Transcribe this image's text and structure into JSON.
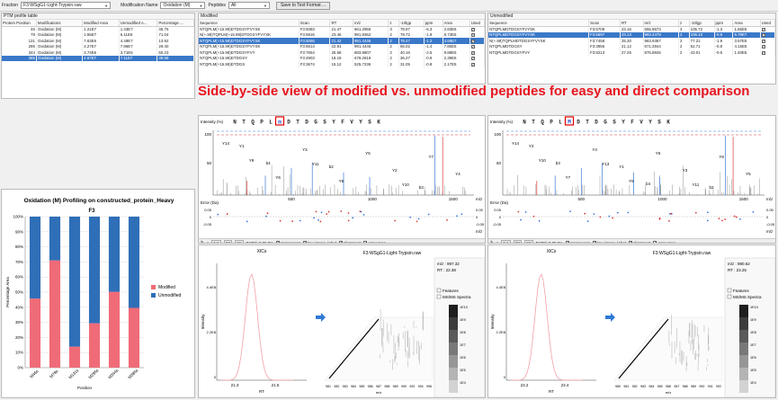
{
  "toolbar": {
    "fraction_label": "Fraction",
    "fraction_value": "F3:WSgG1-Light-Trypsin.raw",
    "modname_label": "Modification Name",
    "modname_value": "Oxidation (M)",
    "peptides_label": "Peptides",
    "peptides_value": "All",
    "save_label": "Save to Text Format ..."
  },
  "ptm_table": {
    "title": "PTM profile table",
    "headers": [
      "Protein Position",
      "Modifications",
      "Modified Area",
      "Unmodified A...",
      "Percentage ..."
    ],
    "rows": [
      [
        "46",
        "Oxidation (M)",
        "1.21E7",
        "1.43E7",
        "45.75"
      ],
      [
        "78",
        "Oxidation (M)",
        "1.55E7",
        "6.11E6",
        "71.04"
      ],
      [
        "131",
        "Oxidation (M)",
        "7.63E6",
        "4.49E7",
        "13.92"
      ],
      [
        "295",
        "Oxidation (M)",
        "3.27E7",
        "7.86E7",
        "29.40"
      ],
      [
        "344",
        "Oxidation (M)",
        "3.74E6",
        "3.71E6",
        "50.23"
      ],
      [
        "385",
        "Oxidation (M)",
        "4.67E7",
        "7.11E7",
        "39.58"
      ]
    ],
    "selected": 5
  },
  "modified": {
    "title": "Modified",
    "headers": [
      "Sequence",
      "Scan",
      "RT",
      "m/z",
      "z",
      "-10lgp",
      "ppm",
      "Area",
      "Used"
    ],
    "rows": [
      [
        "NTQPLM(+15.99)DTDGSYFVYSK",
        "F3:6083",
        "21.47",
        "661.2956",
        "3",
        "79.97",
        "-6.3",
        "2.83E6"
      ],
      [
        "N(+.98)TQPLM(+15.99)DTDGSYFVYSK",
        "F3:6816",
        "23.46",
        "991.9362",
        "2",
        "78.72",
        "-1.8",
        "8.73E5"
      ],
      [
        "NTQPLM(+15.99)DTDGSYFVYSK",
        "F3:6066",
        "21.42",
        "991.4446",
        "2",
        "78.47",
        "-1.2",
        "4.68E7"
      ],
      [
        "NTQPLM(+15.99)DTDGSYFVYSK",
        "F3:6614",
        "22.91",
        "991.4446",
        "2",
        "65.02",
        "-1.4",
        "7.85E5"
      ],
      [
        "NTQPLM(+15.99)DTDGSYFVY",
        "F3:7654",
        "25.68",
        "883.8807",
        "2",
        "40.16",
        "-2.5",
        "9.88E5"
      ],
      [
        "NTQPLM(+15.99)DTDGSY",
        "F3:4903",
        "18.19",
        "679.2819",
        "2",
        "36.27",
        "-0.9",
        "2.39E5"
      ],
      [
        "NTQPLM(+15.99)DTDGS",
        "F3:3674",
        "15.12",
        "525.7236",
        "2",
        "31.05",
        "-0.8",
        "2.17E5"
      ]
    ],
    "selected": 2
  },
  "unmodified": {
    "title": "Unmodified",
    "headers": [
      "Sequence",
      "Scan",
      "RT",
      "m/z",
      "z",
      "-10lgp",
      "ppm",
      "Area",
      "Used"
    ],
    "rows": [
      [
        "NTQPLMDTDGSYFVYSK",
        "F3:6709",
        "23.16",
        "655.9673",
        "3",
        "105.72",
        "-1.3",
        "1.66E6"
      ],
      [
        "NTQPLMDTDGSYFVYSK",
        "F3:6697",
        "23.13",
        "983.4478",
        "2",
        "106.10",
        "-0.9",
        "6.79E7"
      ],
      [
        "N(+.98)TQPLMDTDGSYFVYSK",
        "F3:7458",
        "25.30",
        "983.9387",
        "2",
        "77.21",
        "-1.9",
        "3.57E5"
      ],
      [
        "NTQPLMDTDGSY",
        "F3:3956",
        "21.12",
        "671.2844",
        "2",
        "52.71",
        "-0.8",
        "4.15E5"
      ],
      [
        "NTQPLMDTDGSYFVY",
        "F3:8213",
        "27.26",
        "875.8845",
        "2",
        "43.01",
        "-0.6",
        "1.40E6"
      ]
    ],
    "selected": 1
  },
  "overlay_text": "Side-by-side view of modified vs. unmodified peptides for easy and direct comparison",
  "chart_title": "Oxidation (M) Profiling on constructed_protein_Heavy",
  "chart_data": {
    "type": "bar",
    "title": "Oxidation (M) Profiling on constructed_protein_Heavy",
    "subtitle": "F3",
    "xlabel": "Position",
    "ylabel": "Percentage Area",
    "categories": [
      "M46s",
      "M78s",
      "M131s",
      "M295s",
      "M344s",
      "M385s"
    ],
    "series": [
      {
        "name": "Modified",
        "values": [
          45.75,
          71.04,
          13.92,
          29.4,
          50.23,
          39.58
        ],
        "color": "#f06b78"
      },
      {
        "name": "Unmodified",
        "values": [
          54.25,
          28.96,
          86.08,
          70.6,
          49.77,
          60.42
        ],
        "color": "#2f6fb8"
      }
    ],
    "ylim": [
      0,
      100
    ],
    "yticks": [
      "0%",
      "10%",
      "20%",
      "30%",
      "40%",
      "50%",
      "60%",
      "70%",
      "80%",
      "90%",
      "100%"
    ],
    "legend": "right"
  },
  "spectrum_left": {
    "intensity_label": "Intensity (%)",
    "seq": [
      "N",
      "T",
      "Q",
      "P",
      "L",
      "m",
      "D",
      "T",
      "D",
      "G",
      "S",
      "Y",
      "F",
      "V",
      "Y",
      "S",
      "K"
    ],
    "mod_index": 5,
    "ion_labels": [
      "Y14",
      "Y11",
      "Y10",
      "Y9",
      "Y8",
      "Y7",
      "Y6",
      "Y5",
      "Y4",
      "Y3",
      "Y2",
      "Y1",
      "b2",
      "b3",
      "b4"
    ],
    "xticks": [
      "500",
      "1000",
      "1500"
    ],
    "xunit": "m/z",
    "error_label": "Error (Da)",
    "err_ticks": [
      "0.05",
      "0",
      "-0.05"
    ]
  },
  "spectrum_right": {
    "intensity_label": "Intensity (%)",
    "seq": [
      "N",
      "T",
      "Q",
      "P",
      "L",
      "M",
      "D",
      "T",
      "D",
      "G",
      "S",
      "Y",
      "F",
      "V",
      "Y",
      "S",
      "K"
    ],
    "mod_index": 5,
    "ion_labels": [
      "Y14",
      "Y13",
      "Y11",
      "Y10",
      "Y9",
      "Y8",
      "Y7",
      "Y6",
      "Y5",
      "Y4",
      "Y3",
      "Y2",
      "Y1",
      "b2",
      "b3",
      "b4"
    ],
    "xticks": [
      "500",
      "1000",
      "1500"
    ],
    "xunit": "m/z",
    "error_label": "Error (Da)",
    "err_ticks": [
      "0.05",
      "0",
      "-0.05"
    ]
  },
  "spec_toolbar": {
    "b1": "1:1",
    "b2": "2X",
    "b3": "2Y",
    "err": "ErrTol: 0.05 Da",
    "c1": "preprocess",
    "c2": "low intens. label",
    "c3": "alignment",
    "c4": "error map"
  },
  "xic_left": {
    "title": "XICs",
    "file": "F3:WSgG1-Light-Trypsin.raw",
    "y_label": "Intensity",
    "yticks": [
      "4.4E8",
      "2.2E8",
      "0"
    ],
    "xticks": [
      "21.3",
      "21.6"
    ],
    "xunit": "RT",
    "mz": "m/z : 997.32",
    "rt": "RT : 22.38",
    "features": "Features",
    "msms": "MS/MS Spectra",
    "scale": [
      "1E10",
      "1E9",
      "1E8",
      "1E7",
      "1E6",
      "1E5",
      "1E4"
    ],
    "axis3d": [
      "981",
      "982",
      "983",
      "984",
      "985",
      "986",
      "987",
      "988",
      "989",
      "990",
      "992",
      "994",
      "996"
    ],
    "mz_unit": "m/z"
  },
  "xic_right": {
    "title": "XICs",
    "file": "F3:WSgG1-Light-Trypsin.raw",
    "y_label": "Intensity",
    "yticks": [
      "4.4E8",
      "2.2E8",
      "0"
    ],
    "xticks": [
      "23.2",
      "23.4"
    ],
    "xunit": "RT",
    "mz": "m/z : 980.62",
    "rt": "RT : 23.25",
    "features": "Features",
    "msms": "MS/MS Spectra",
    "scale": [
      "1E10",
      "1E9",
      "1E8",
      "1E7",
      "1E6",
      "1E5",
      "1E4"
    ],
    "axis3d": [
      "980",
      "981",
      "982",
      "983",
      "984",
      "985",
      "986",
      "987",
      "988",
      "989",
      "990",
      "991",
      "992"
    ],
    "mz_unit": "m/z"
  }
}
